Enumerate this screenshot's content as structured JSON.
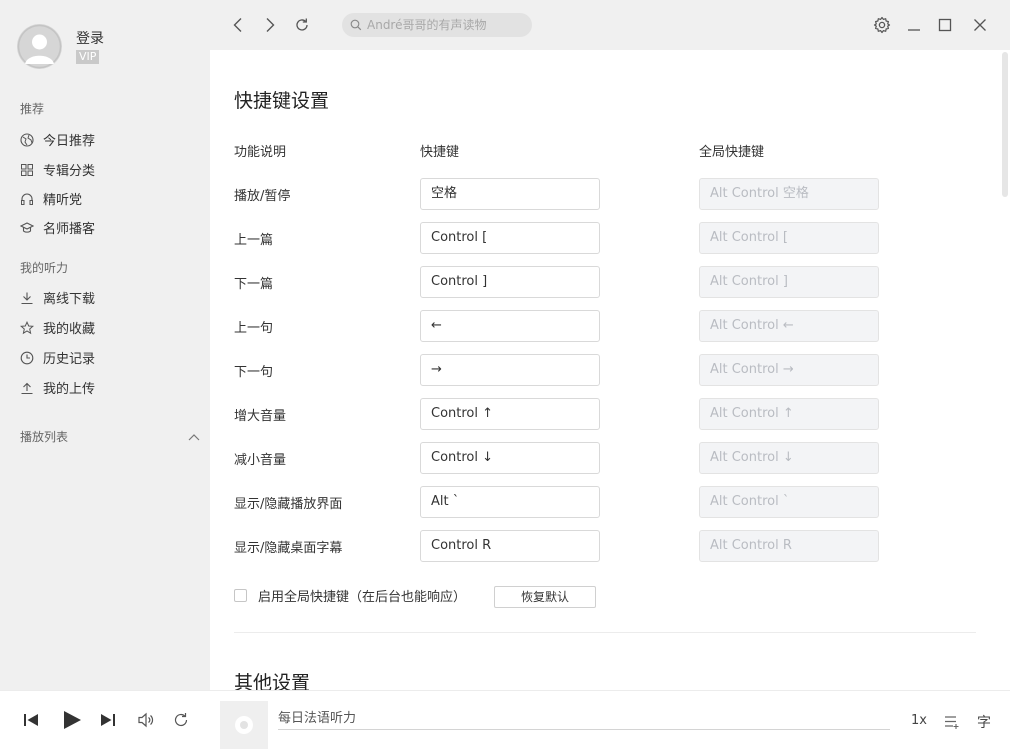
{
  "sidebar": {
    "user": {
      "login_label": "登录",
      "vip_badge": "VIP"
    },
    "section_recommend": "推荐",
    "recommend_items": [
      {
        "label": "今日推荐",
        "icon": "globe-icon"
      },
      {
        "label": "专辑分类",
        "icon": "grid-icon"
      },
      {
        "label": "精听党",
        "icon": "headphones-icon"
      },
      {
        "label": "名师播客",
        "icon": "graduation-cap-icon"
      }
    ],
    "section_mine": "我的听力",
    "mine_items": [
      {
        "label": "离线下载",
        "icon": "download-icon"
      },
      {
        "label": "我的收藏",
        "icon": "star-icon"
      },
      {
        "label": "历史记录",
        "icon": "clock-icon"
      },
      {
        "label": "我的上传",
        "icon": "upload-icon"
      }
    ],
    "playlist_label": "播放列表"
  },
  "topbar": {
    "search_placeholder": "André哥哥的有声读物"
  },
  "shortcuts": {
    "title": "快捷键设置",
    "col_function": "功能说明",
    "col_shortcut": "快捷键",
    "col_global": "全局快捷键",
    "rows": [
      {
        "label": "播放/暂停",
        "shortcut": "空格",
        "global": "Alt Control 空格"
      },
      {
        "label": "上一篇",
        "shortcut": "Control [",
        "global": "Alt Control ["
      },
      {
        "label": "下一篇",
        "shortcut": "Control ]",
        "global": "Alt Control ]"
      },
      {
        "label": "上一句",
        "shortcut": "←",
        "global": "Alt Control ←"
      },
      {
        "label": "下一句",
        "shortcut": "→",
        "global": "Alt Control →"
      },
      {
        "label": "增大音量",
        "shortcut": "Control ↑",
        "global": "Alt Control ↑"
      },
      {
        "label": "减小音量",
        "shortcut": "Control ↓",
        "global": "Alt Control ↓"
      },
      {
        "label": "显示/隐藏播放界面",
        "shortcut": "Alt `",
        "global": "Alt Control `"
      },
      {
        "label": "显示/隐藏桌面字幕",
        "shortcut": "Control R",
        "global": "Alt Control R"
      }
    ],
    "enable_global_label": "启用全局快捷键（在后台也能响应）",
    "enable_global_checked": false,
    "reset_label": "恢复默认"
  },
  "other_settings_title": "其他设置",
  "player": {
    "track_title": "每日法语听力",
    "speed": "1x",
    "lyric_label": "字"
  }
}
